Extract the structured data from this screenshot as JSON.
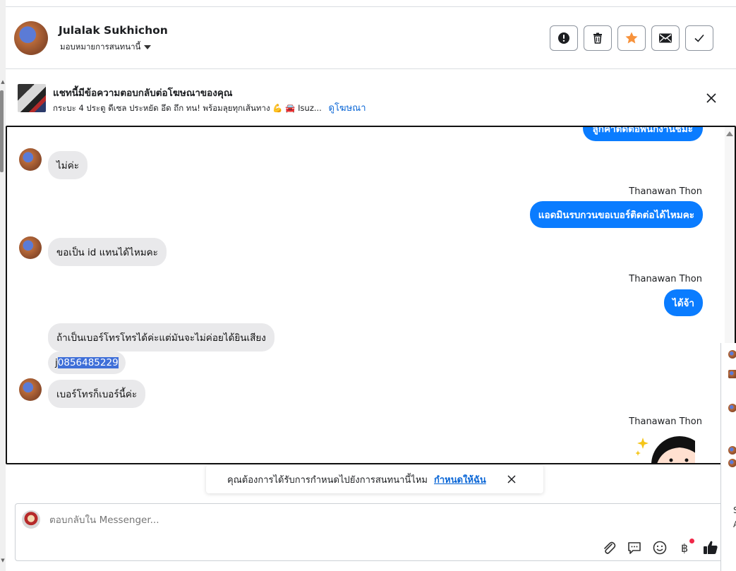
{
  "header": {
    "contact_name": "Julalak Sukhichon",
    "assign_label": "มอบหมายการสนทนานี้",
    "actions": [
      {
        "name": "spam",
        "icon": "exclamation-circle-icon"
      },
      {
        "name": "delete",
        "icon": "trash-icon"
      },
      {
        "name": "star",
        "icon": "star-icon",
        "color": "#f7923b"
      },
      {
        "name": "mark-unread",
        "icon": "envelope-icon"
      },
      {
        "name": "mark-done",
        "icon": "check-icon"
      }
    ]
  },
  "ad": {
    "title": "แชทนี้มีข้อความตอบกลับต่อโฆษณาของคุณ",
    "subtitle": "กระบะ 4 ประตู ดีเซล ประหยัด อึด ถึก ทน! พร้อมลุยทุกเส้นทาง 💪 🚘 Isuz...",
    "link": "ดูโฆษณา"
  },
  "messages": {
    "cut_top": "ลูกค้าติดต่อพนักงานชมะ",
    "m1": "ไม่ค่ะ",
    "sender": "Thanawan Thon",
    "m2": "แอดมินรบกวนขอเบอร์ติดต่อได้ไหมคะ",
    "m3": "ขอเป็น id แทนได้ไหมคะ",
    "m4": "ได้จ้า",
    "m5": "ถ้าเป็นเบอร์โทรโทรได้ค่ะแต่มันจะไม่ค่อยได้ยินเสียง",
    "m6_prefix": "j",
    "m6_highlight": "0856485229",
    "m7": "เบอร์โทรก็เบอร์นี้ค่ะ"
  },
  "toast": {
    "text": "คุณต้องการได้รับการกำหนดไปยังการสนทนานี้ไหม",
    "link": "กำหนดให้ฉัน"
  },
  "composer": {
    "placeholder": "ตอบกลับใน Messenger...",
    "tools": [
      "paperclip-icon",
      "saved-reply-icon",
      "emoji-icon",
      "baht-icon",
      "thumbs-up-icon"
    ],
    "accent": "#0a7cff"
  },
  "right_panel": {
    "letters": [
      "S",
      "A"
    ]
  },
  "colors": {
    "outgoing_bubble": "#0a7cff",
    "incoming_bubble": "#e9e9eb",
    "link": "#0a66d6"
  }
}
